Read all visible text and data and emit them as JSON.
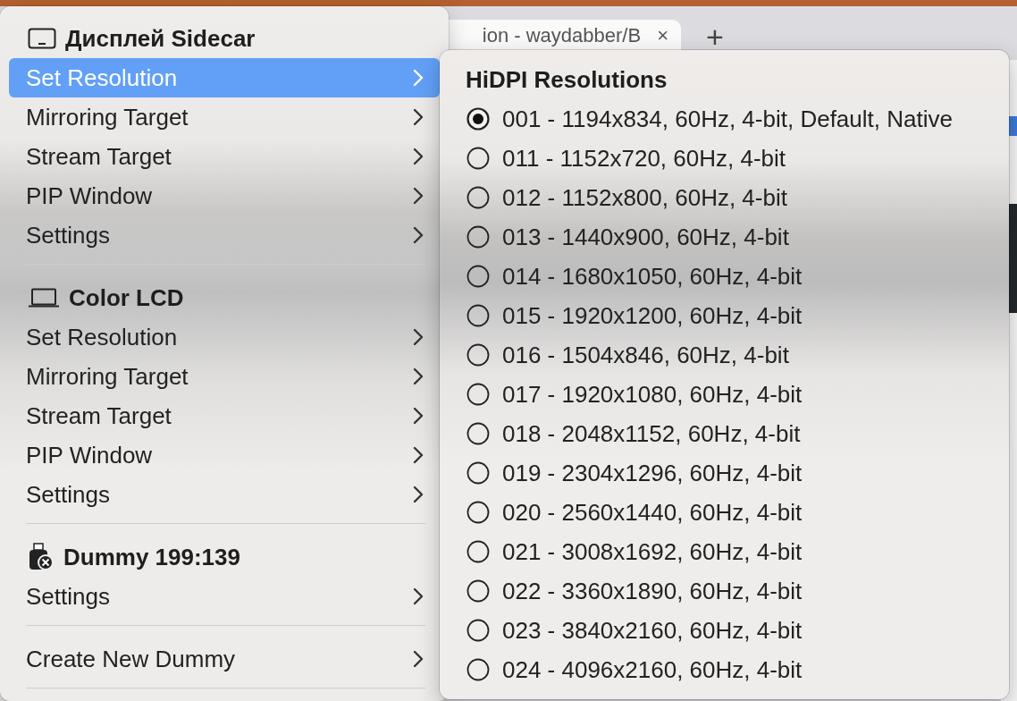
{
  "browser": {
    "tab_title": "ion - waydabber/B",
    "tab_close": "×",
    "new_tab": "+"
  },
  "menu": {
    "sections": [
      {
        "kind": "tablet",
        "title": "Дисплей Sidecar",
        "items": [
          {
            "label": "Set Resolution",
            "selected": true
          },
          {
            "label": "Mirroring Target",
            "selected": false
          },
          {
            "label": "Stream Target",
            "selected": false
          },
          {
            "label": "PIP Window",
            "selected": false
          },
          {
            "label": "Settings",
            "selected": false
          }
        ]
      },
      {
        "kind": "laptop",
        "title": "Color LCD",
        "items": [
          {
            "label": "Set Resolution",
            "selected": false
          },
          {
            "label": "Mirroring Target",
            "selected": false
          },
          {
            "label": "Stream Target",
            "selected": false
          },
          {
            "label": "PIP Window",
            "selected": false
          },
          {
            "label": "Settings",
            "selected": false
          }
        ]
      },
      {
        "kind": "dummy",
        "title": "Dummy 199:139",
        "items": [
          {
            "label": "Settings",
            "selected": false
          }
        ]
      },
      {
        "kind": "actions",
        "items": [
          {
            "label": "Create New Dummy",
            "selected": false
          }
        ]
      }
    ]
  },
  "submenu": {
    "title": "HiDPI Resolutions",
    "options": [
      {
        "label": "001 - 1194x834, 60Hz, 4-bit, Default, Native",
        "selected": true
      },
      {
        "label": "011 - 1152x720, 60Hz, 4-bit",
        "selected": false
      },
      {
        "label": "012 - 1152x800, 60Hz, 4-bit",
        "selected": false
      },
      {
        "label": "013 - 1440x900, 60Hz, 4-bit",
        "selected": false
      },
      {
        "label": "014 - 1680x1050, 60Hz, 4-bit",
        "selected": false
      },
      {
        "label": "015 - 1920x1200, 60Hz, 4-bit",
        "selected": false
      },
      {
        "label": "016 - 1504x846, 60Hz, 4-bit",
        "selected": false
      },
      {
        "label": "017 - 1920x1080, 60Hz, 4-bit",
        "selected": false
      },
      {
        "label": "018 - 2048x1152, 60Hz, 4-bit",
        "selected": false
      },
      {
        "label": "019 - 2304x1296, 60Hz, 4-bit",
        "selected": false
      },
      {
        "label": "020 - 2560x1440, 60Hz, 4-bit",
        "selected": false
      },
      {
        "label": "021 - 3008x1692, 60Hz, 4-bit",
        "selected": false
      },
      {
        "label": "022 - 3360x1890, 60Hz, 4-bit",
        "selected": false
      },
      {
        "label": "023 - 3840x2160, 60Hz, 4-bit",
        "selected": false
      },
      {
        "label": "024 - 4096x2160, 60Hz, 4-bit",
        "selected": false
      }
    ]
  }
}
